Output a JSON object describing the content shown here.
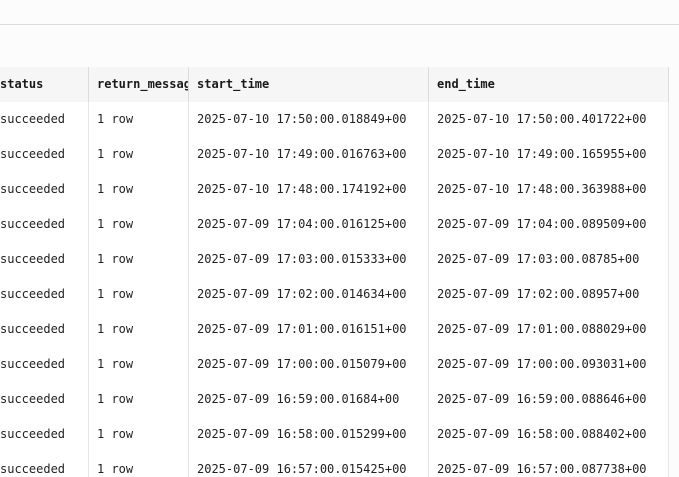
{
  "table": {
    "columns": [
      "status",
      "return_message",
      "start_time",
      "end_time"
    ],
    "rows": [
      [
        "succeeded",
        "1 row",
        "2025-07-10 17:50:00.018849+00",
        "2025-07-10 17:50:00.401722+00"
      ],
      [
        "succeeded",
        "1 row",
        "2025-07-10 17:49:00.016763+00",
        "2025-07-10 17:49:00.165955+00"
      ],
      [
        "succeeded",
        "1 row",
        "2025-07-10 17:48:00.174192+00",
        "2025-07-10 17:48:00.363988+00"
      ],
      [
        "succeeded",
        "1 row",
        "2025-07-09 17:04:00.016125+00",
        "2025-07-09 17:04:00.089509+00"
      ],
      [
        "succeeded",
        "1 row",
        "2025-07-09 17:03:00.015333+00",
        "2025-07-09 17:03:00.08785+00"
      ],
      [
        "succeeded",
        "1 row",
        "2025-07-09 17:02:00.014634+00",
        "2025-07-09 17:02:00.08957+00"
      ],
      [
        "succeeded",
        "1 row",
        "2025-07-09 17:01:00.016151+00",
        "2025-07-09 17:01:00.088029+00"
      ],
      [
        "succeeded",
        "1 row",
        "2025-07-09 17:00:00.015079+00",
        "2025-07-09 17:00:00.093031+00"
      ],
      [
        "succeeded",
        "1 row",
        "2025-07-09 16:59:00.01684+00",
        "2025-07-09 16:59:00.088646+00"
      ],
      [
        "succeeded",
        "1 row",
        "2025-07-09 16:58:00.015299+00",
        "2025-07-09 16:58:00.088402+00"
      ],
      [
        "succeeded",
        "1 row",
        "2025-07-09 16:57:00.015425+00",
        "2025-07-09 16:57:00.087738+00"
      ]
    ]
  }
}
